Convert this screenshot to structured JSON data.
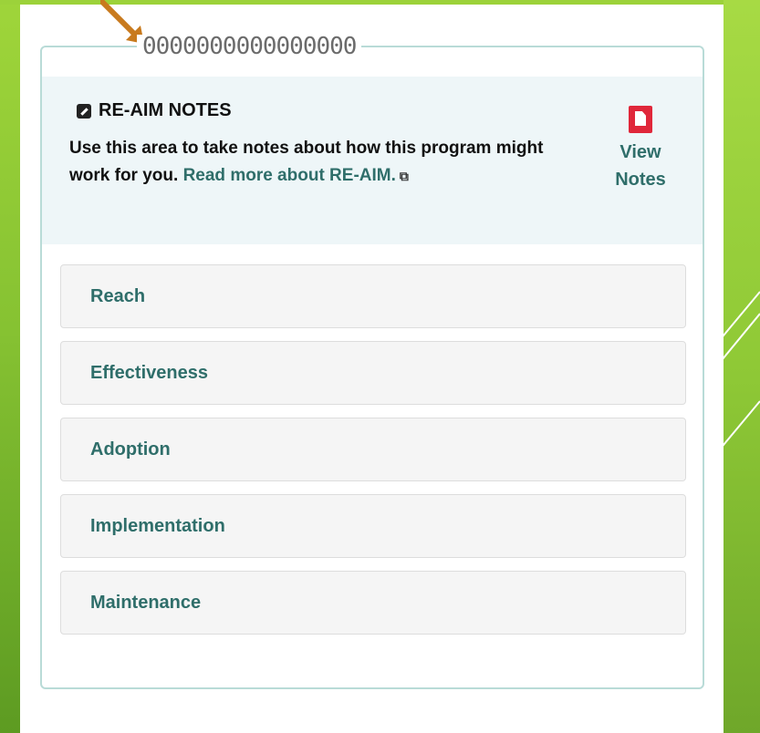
{
  "notes": {
    "title": "RE-AIM NOTES",
    "description": "Use this area to take notes about how this program might work for you.",
    "link_text": "Read more about RE-AIM.",
    "view_label_1": "View",
    "view_label_2": "Notes",
    "edit_icon": "edit-icon",
    "doc_icon": "document-icon"
  },
  "rings": "0000000000000000",
  "items": [
    {
      "label": "Reach"
    },
    {
      "label": "Effectiveness"
    },
    {
      "label": "Adoption"
    },
    {
      "label": "Implementation"
    },
    {
      "label": "Maintenance"
    }
  ],
  "colors": {
    "accent": "#2f6e6a",
    "panel": "#eef6f8",
    "doc_red": "#e0273a",
    "green_bg": "#86c232"
  }
}
